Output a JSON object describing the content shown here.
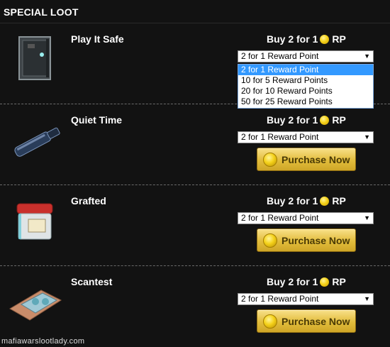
{
  "page": {
    "title": "SPECIAL LOOT"
  },
  "items": [
    {
      "name": "Play It Safe",
      "buy_prefix": "Buy 2 for 1",
      "buy_suffix": "RP",
      "select_value": "2 for 1 Reward Point"
    },
    {
      "name": "Quiet Time",
      "buy_prefix": "Buy 2 for 1",
      "buy_suffix": "RP",
      "select_value": "2 for 1 Reward Point",
      "button_label": "Purchase Now"
    },
    {
      "name": "Grafted",
      "buy_prefix": "Buy 2 for 1",
      "buy_suffix": "RP",
      "select_value": "2 for 1 Reward Point",
      "button_label": "Purchase Now"
    },
    {
      "name": "Scantest",
      "buy_prefix": "Buy 2 for 1",
      "buy_suffix": "RP",
      "select_value": "2 for 1 Reward Point",
      "button_label": "Purchase Now"
    }
  ],
  "dropdown": {
    "options": [
      "2 for 1 Reward Point",
      "10 for 5 Reward Points",
      "20 for 10 Reward Points",
      "50 for 25 Reward Points"
    ],
    "selected_index": 0
  },
  "watermark": "mafiawarslootlady.com",
  "icons": {
    "coin": "coin-icon",
    "dropdown_arrow": "chevron-down-icon"
  }
}
